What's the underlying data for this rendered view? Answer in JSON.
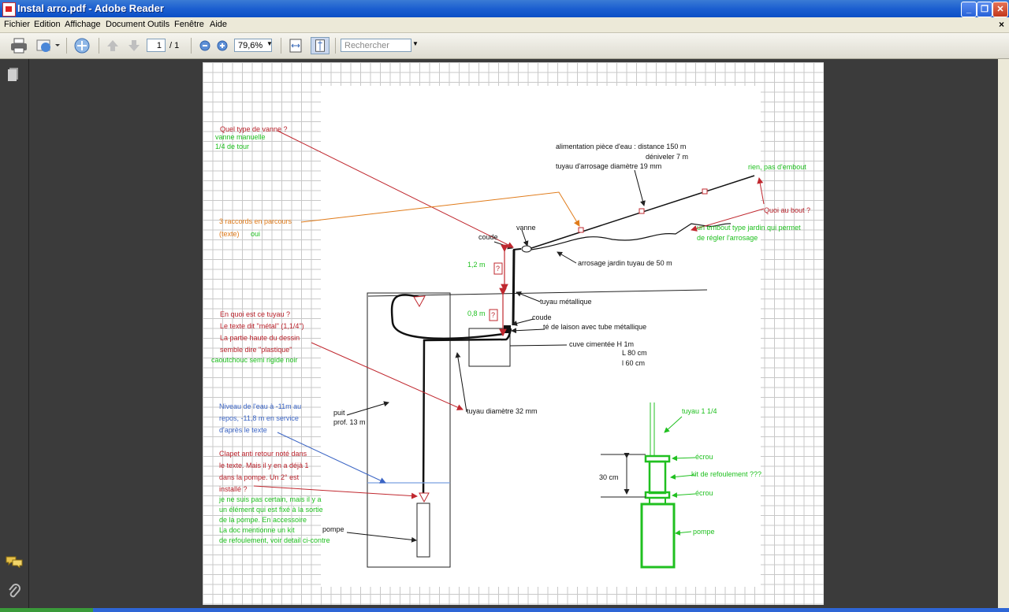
{
  "window": {
    "title": "Instal arro.pdf - Adobe Reader",
    "minimize": "_",
    "restore": "❐",
    "close": "✕"
  },
  "menu": {
    "items": [
      "Fichier",
      "Edition",
      "Affichage",
      "Document",
      "Outils",
      "Fenêtre",
      "Aide"
    ],
    "close_doc": "×"
  },
  "toolbar": {
    "page_current": "1",
    "page_total": "/ 1",
    "zoom": "79,6%",
    "search_placeholder": "Rechercher"
  },
  "drawing": {
    "left_notes": {
      "q_vanne": "Quel type de vanne ?",
      "a_vanne_1": "vanne  manuelle",
      "a_vanne_2": "1/4 de tour",
      "raccords": "3 raccords en parcours",
      "texte": "(texte)",
      "oui": "oui",
      "q_tuyau": "En quoi est ce tuyau ?",
      "texte_metal": "Le texte dit \"métal\" (1,1/4\")",
      "partie_haute": "La partie haute du dessin",
      "semble_plastique": "semble dire \"plastique\"",
      "caoutchouc": "caoutchouc semi rigide noir",
      "niveau_1": "Niveau de l'eau à -11m au",
      "niveau_2": "repos, -11,8 m en service",
      "niveau_3": "d'après le texte",
      "clapet_1": "Clapet anti retour noté dans",
      "clapet_2": "le texte. Mais il y en a déjà 1",
      "clapet_3": "dans la pompe. Un 2° est",
      "clapet_4": "installé ?",
      "reponse_1": "je ne suis pas certain, mais il y a",
      "reponse_2": "un élément qui est fixé à la sortie",
      "reponse_3": "de la pompe. En accessoire",
      "reponse_4": "La doc mentionne un kit",
      "reponse_5": "de refoulement, voir detail ci-contre"
    },
    "labels": {
      "alimentation": "alimentation pièce d'eau  : distance 150 m",
      "deniveler": "déniveler 7 m",
      "tuyau_arrosage": "tuyau d'arrosage diamètre 19 mm",
      "rien_embout": "rien, pas d'embout",
      "quoi_bout": "Quoi au bout ?",
      "embout_1": "un embout type jardin qui permet",
      "embout_2": "de régler l'arrosage",
      "vanne": "vanne",
      "coude1": "coude",
      "arrosage_jardin": "arrosage jardin tuyau de 50 m",
      "h12": "1,2 m",
      "q1": "?",
      "tuyau_metal": "tuyau métallique",
      "h08": "0,8 m",
      "q2": "?",
      "coude2": "coude",
      "te_liaison": "té de laison avec tube métallique",
      "cuve": "cuve cimentée H 1m",
      "cuve_l": "L 80 cm",
      "cuve_w": "l 60 cm",
      "puit": "puit",
      "prof": "prof. 13 m",
      "tuyau32": "tuyau  diamètre 32 mm",
      "pompe": "pompe",
      "tuyau114": "tuyau 1 1/4",
      "ecrou1": "écrou",
      "kit": "kit de refoulement ???",
      "ecrou2": "écrou",
      "cm30": "30 cm",
      "pompe2": "pompe"
    }
  },
  "colors": {
    "red": "#b8212a",
    "green": "#20c020",
    "orange": "#e07b1a",
    "blue": "#3a64c4"
  }
}
